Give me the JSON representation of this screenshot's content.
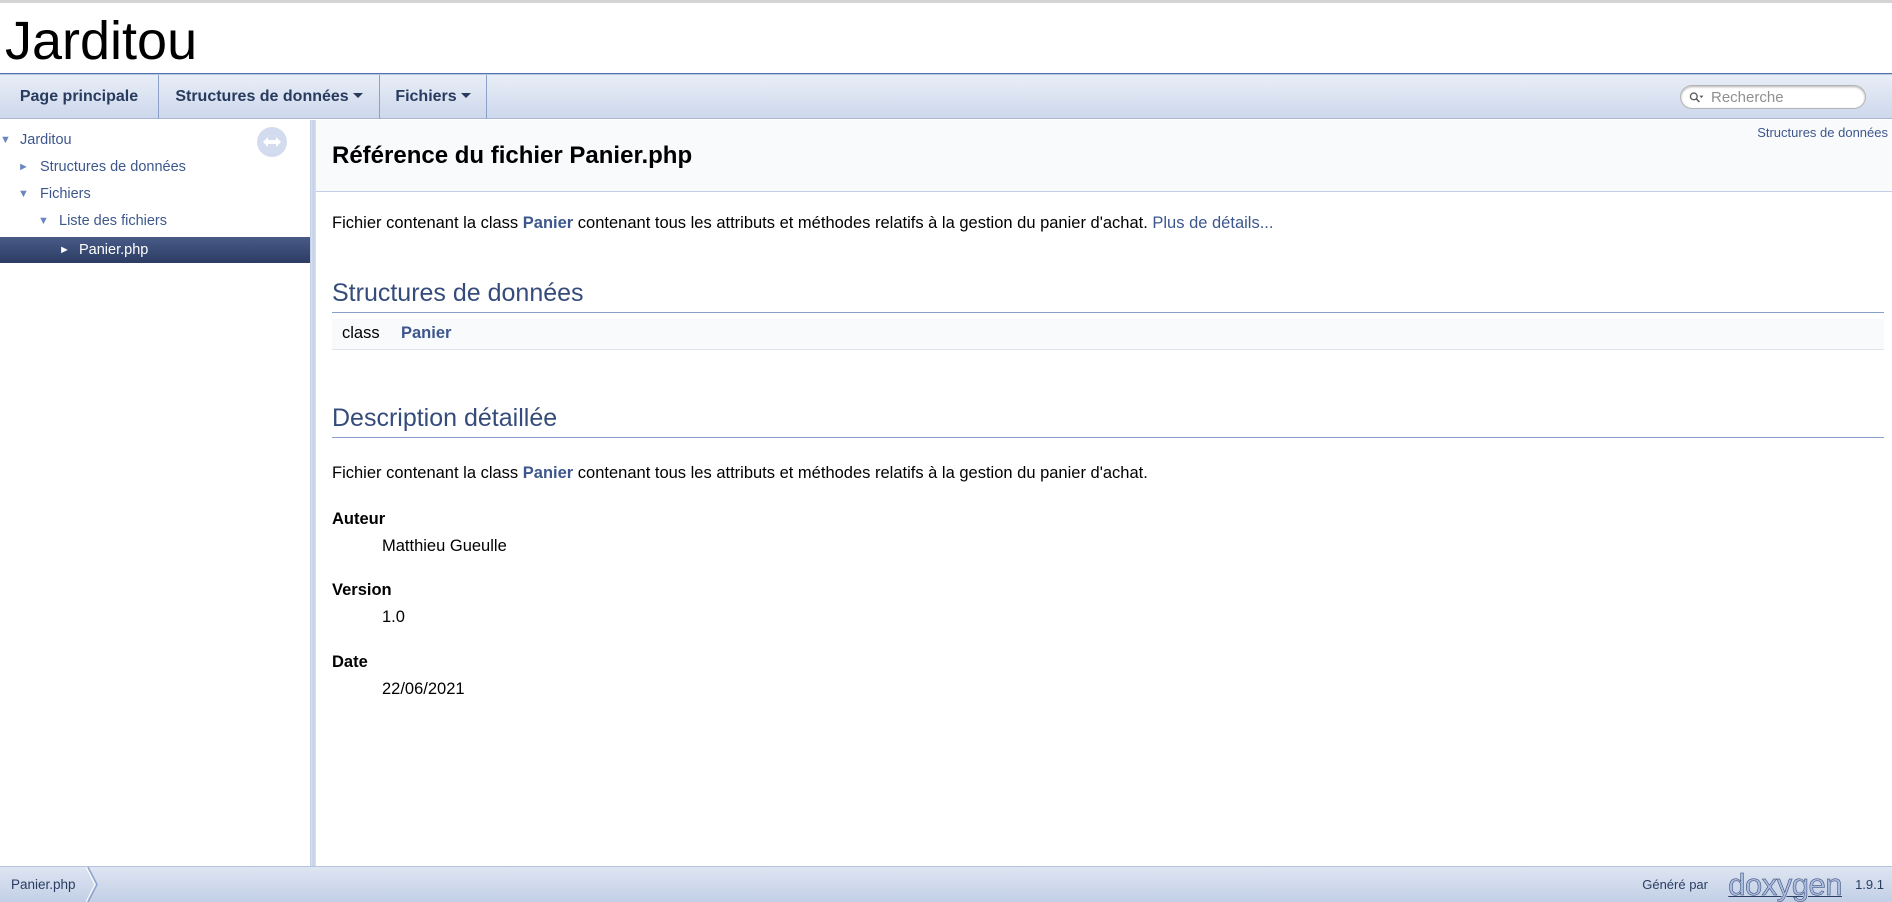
{
  "project": {
    "name": "Jarditou"
  },
  "navbar": {
    "main_page": "Page principale",
    "data_structures": "Structures de données",
    "files": "Fichiers",
    "search_placeholder": "Recherche"
  },
  "sidebar": {
    "tree": [
      {
        "label": "Jarditou",
        "arrow": "▼"
      },
      {
        "label": "Structures de données",
        "arrow": "►"
      },
      {
        "label": "Fichiers",
        "arrow": "▼"
      },
      {
        "label": "Liste des fichiers",
        "arrow": "▼"
      },
      {
        "label": "Panier.php",
        "arrow": "►",
        "selected": true
      }
    ]
  },
  "content": {
    "summary_link": "Structures de données",
    "title": "Référence du fichier Panier.php",
    "brief": {
      "before": "Fichier contenant la class ",
      "link": "Panier",
      "after": " contenant tous les attributs et méthodes relatifs à la gestion du panier d'achat. ",
      "more": "Plus de détails..."
    },
    "structures_heading": "Structures de données",
    "member": {
      "type": "class",
      "name": "Panier"
    },
    "detail_heading": "Description détaillée",
    "detail": {
      "before": "Fichier contenant la class ",
      "link": "Panier",
      "after": " contenant tous les attributs et méthodes relatifs à la gestion du panier d'achat."
    },
    "params": [
      {
        "term": "Auteur",
        "value": "Matthieu Gueulle"
      },
      {
        "term": "Version",
        "value": "1.0"
      },
      {
        "term": "Date",
        "value": "22/06/2021"
      }
    ]
  },
  "footer": {
    "breadcrumb": "Panier.php",
    "generated_by": "Généré par",
    "logo_text": "doxygen",
    "version": "1.9.1"
  },
  "colors": {
    "link": "#3d578c",
    "selected_bg": "#33456b",
    "heading": "#354c7b"
  }
}
